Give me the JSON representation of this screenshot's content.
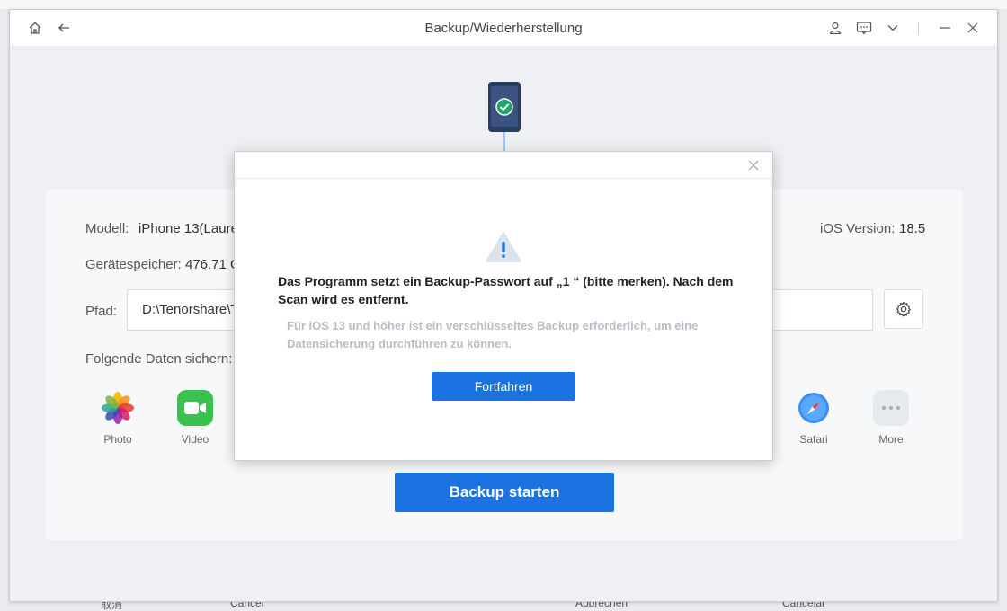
{
  "window": {
    "title": "Backup/Wiederherstellung"
  },
  "device": {
    "model_label": "Modell:",
    "model_value": "iPhone 13(Laure",
    "storage_label": "Gerätespeicher:",
    "storage_value": "476.71 G",
    "ios_label": "iOS Version:",
    "ios_value": "18.5",
    "path_label": "Pfad:",
    "path_value": "D:\\Tenorshare\\T"
  },
  "backup": {
    "section_label": "Folgende Daten sichern:",
    "apps": [
      {
        "label": "Photo",
        "icon": "photos-icon"
      },
      {
        "label": "Video",
        "icon": "facetime-icon"
      },
      {
        "label": "Safari",
        "icon": "safari-icon"
      },
      {
        "label": "More",
        "icon": "more-icon"
      }
    ],
    "start_label": "Backup starten"
  },
  "dialog": {
    "main_text": "Das Programm setzt ein Backup-Passwort auf „1  “ (bitte merken). Nach dem Scan wird es entfernt.",
    "sub_text": "Für iOS 13 und höher ist ein verschlüsseltes Backup erforderlich, um eine Datensicherung durchführen zu können.",
    "continue_label": "Fortfahren"
  },
  "background_text": {
    "bottom_1": "取消",
    "bottom_2": "Cancel",
    "bottom_3": "Abbrechen",
    "bottom_4": "Cancelar"
  },
  "colors": {
    "accent": "#1a73e0",
    "success": "#1fa66f",
    "warning_bg": "#dde3ec"
  }
}
